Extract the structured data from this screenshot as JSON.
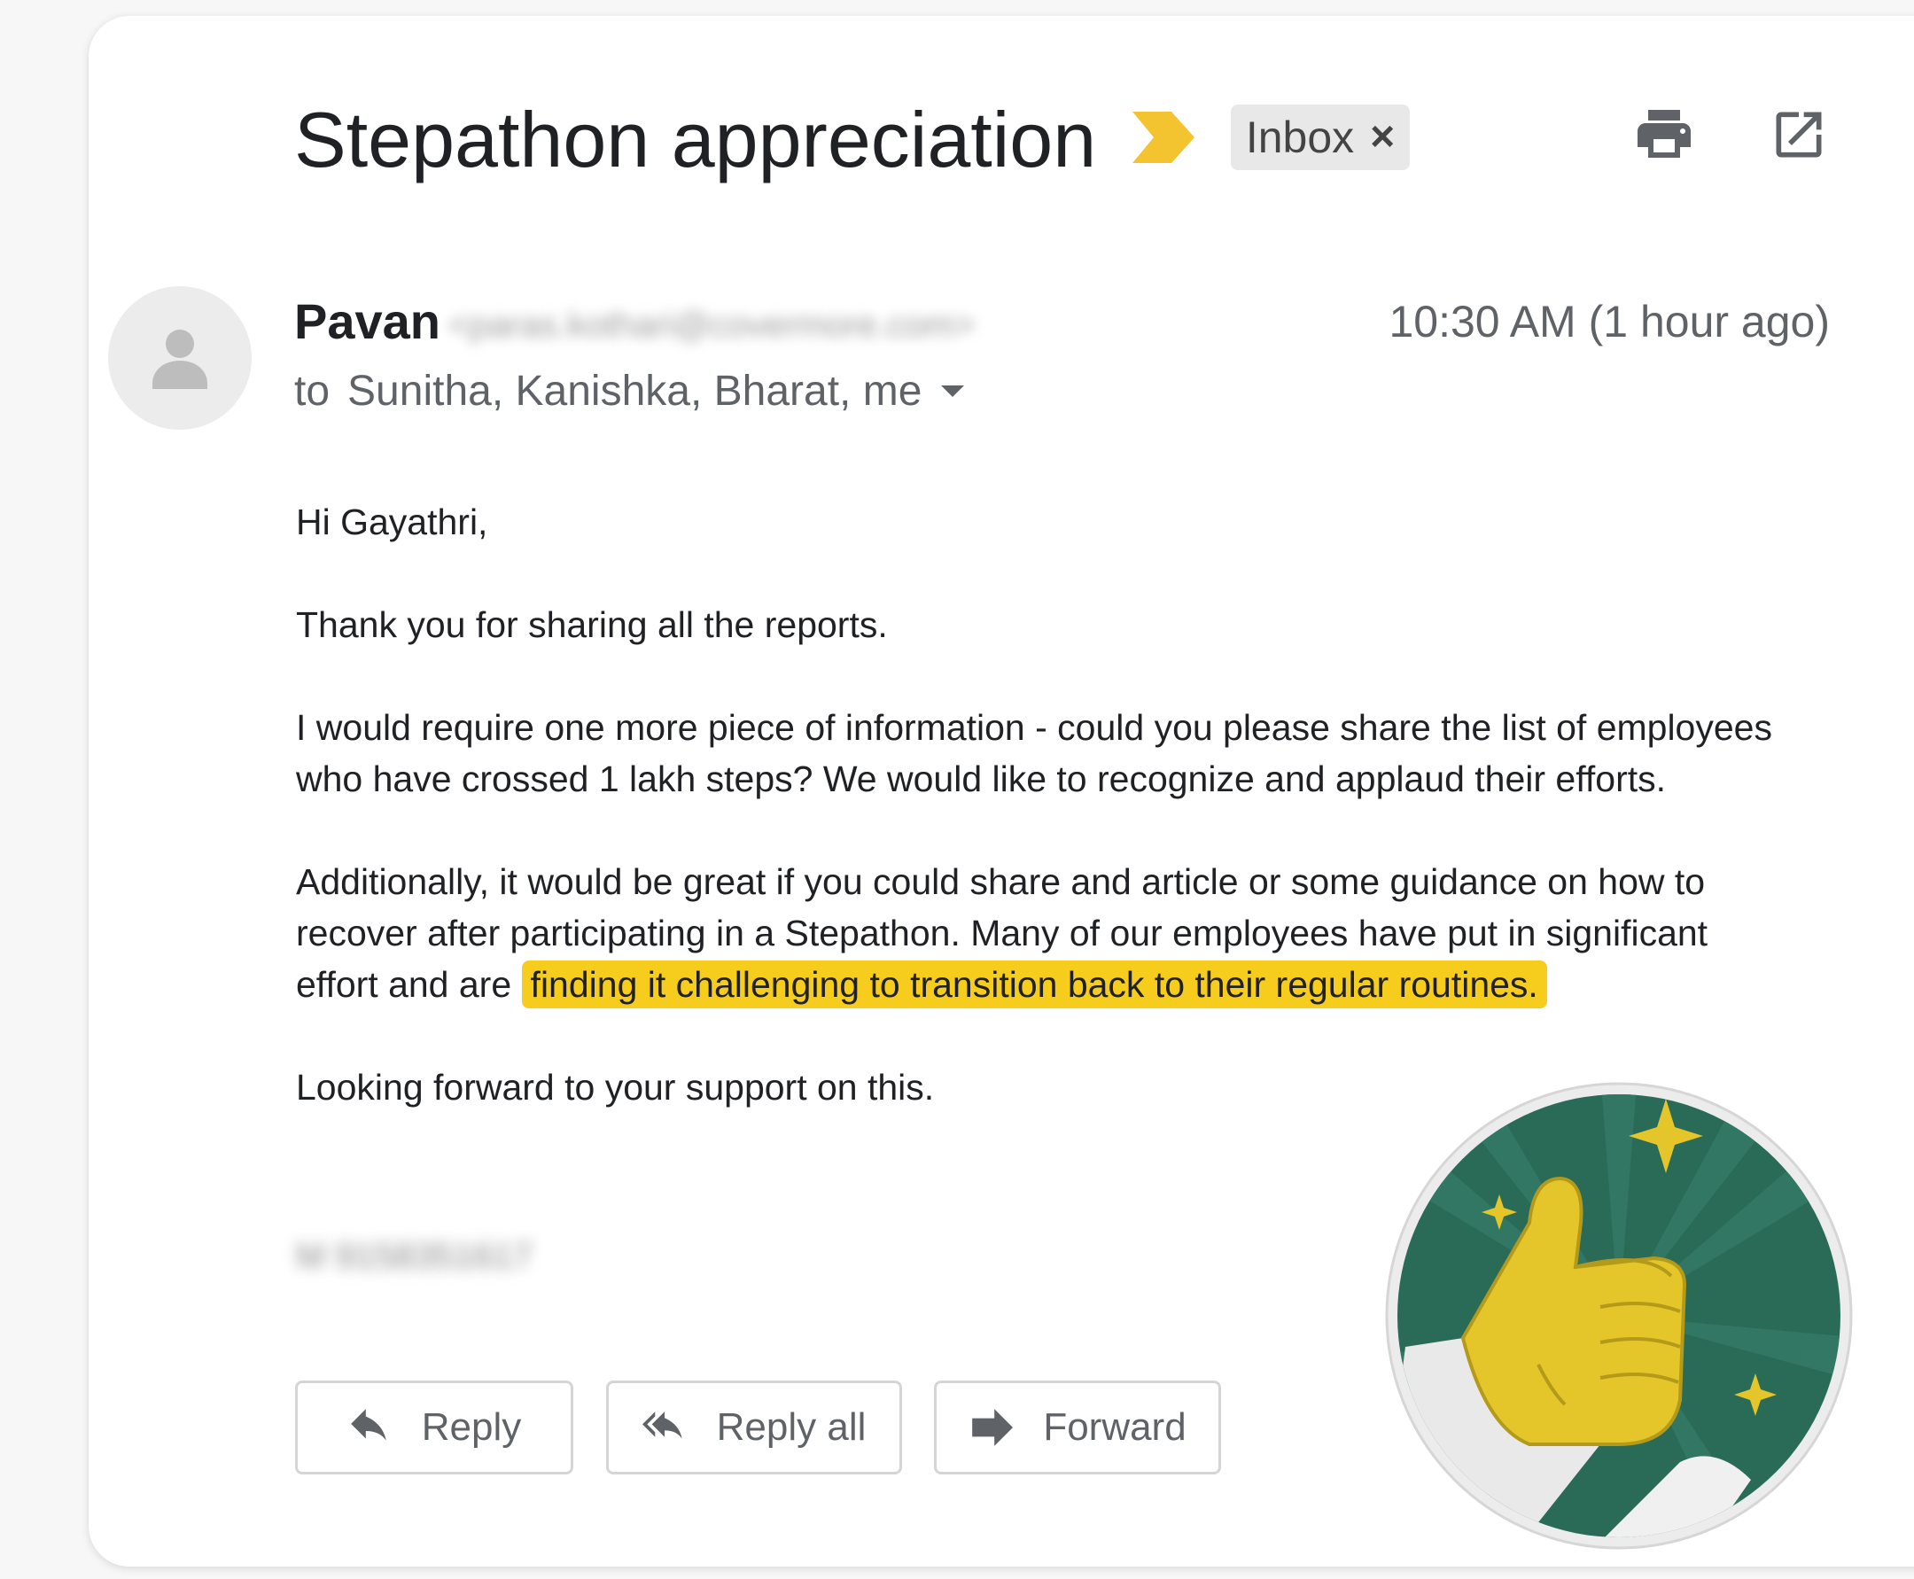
{
  "email": {
    "subject": "Stepathon appreciation",
    "label": "Inbox",
    "label_remove_glyph": "×",
    "sender_name": "Pavan",
    "sender_email": "<paras.kothari@covermore.com>",
    "timestamp": "10:30 AM (1 hour ago)",
    "to_word": "to",
    "recipients": "Sunitha, Kanishka, Bharat, me",
    "greeting": "Hi Gayathri,",
    "p1": "Thank you for sharing all the reports.",
    "p2": "I would require one more piece of information - could you please share the list of employees who have crossed 1 lakh steps? We would like to recognize and applaud their efforts.",
    "p3_start": "Additionally, it would be great if you could share and article or some guidance on how to recover after participating in a Stepathon. Many of our employees have put in significant effort and are",
    "p3_highlight": "finding it challenging to transition back to their regular routines.",
    "closing": "Looking forward to your support on this.",
    "signature": "M 9158351617"
  },
  "actions": {
    "reply": "Reply",
    "reply_all": "Reply all",
    "forward": "Forward"
  },
  "icons": {
    "importance": "importance-marker-icon",
    "print": "print-icon",
    "popout": "open-in-new-window-icon",
    "avatar": "default-avatar-icon",
    "sticker": "thumbs-up-sticker"
  },
  "colors": {
    "highlight": "#f7cd1d",
    "importance": "#f4c430",
    "sticker_green": "#2a6b58"
  }
}
